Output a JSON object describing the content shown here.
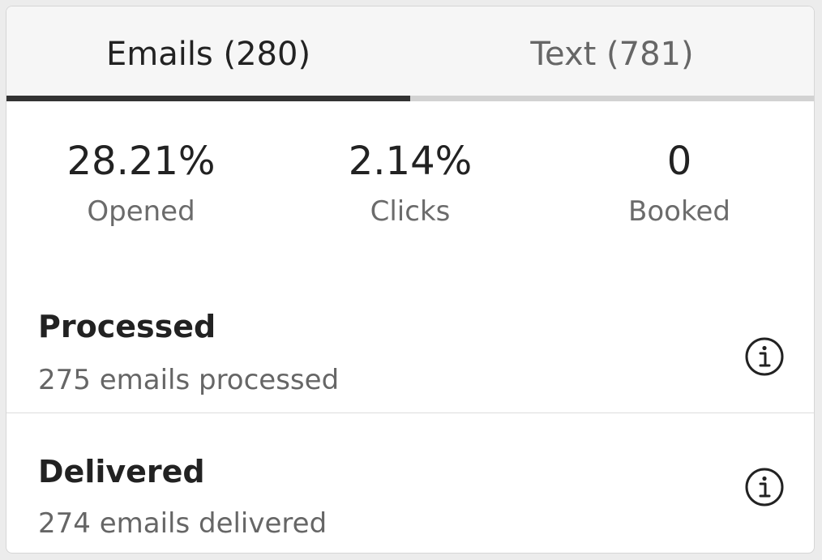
{
  "tabs": [
    {
      "label": "Emails (280)",
      "active": true
    },
    {
      "label": "Text (781)",
      "active": false
    }
  ],
  "stats": [
    {
      "value": "28.21%",
      "label": "Opened"
    },
    {
      "value": "2.14%",
      "label": "Clicks"
    },
    {
      "value": "0",
      "label": "Booked"
    }
  ],
  "rows": [
    {
      "title": "Processed",
      "subtitle": "275 emails processed",
      "icon": "info-icon"
    },
    {
      "title": "Delivered",
      "subtitle": "274 emails delivered",
      "icon": "info-icon"
    }
  ],
  "colors": {
    "active_tab_underline": "#333333",
    "inactive_tab_underline": "#d2d2d2",
    "tab_bar_bg": "#f6f6f6"
  }
}
